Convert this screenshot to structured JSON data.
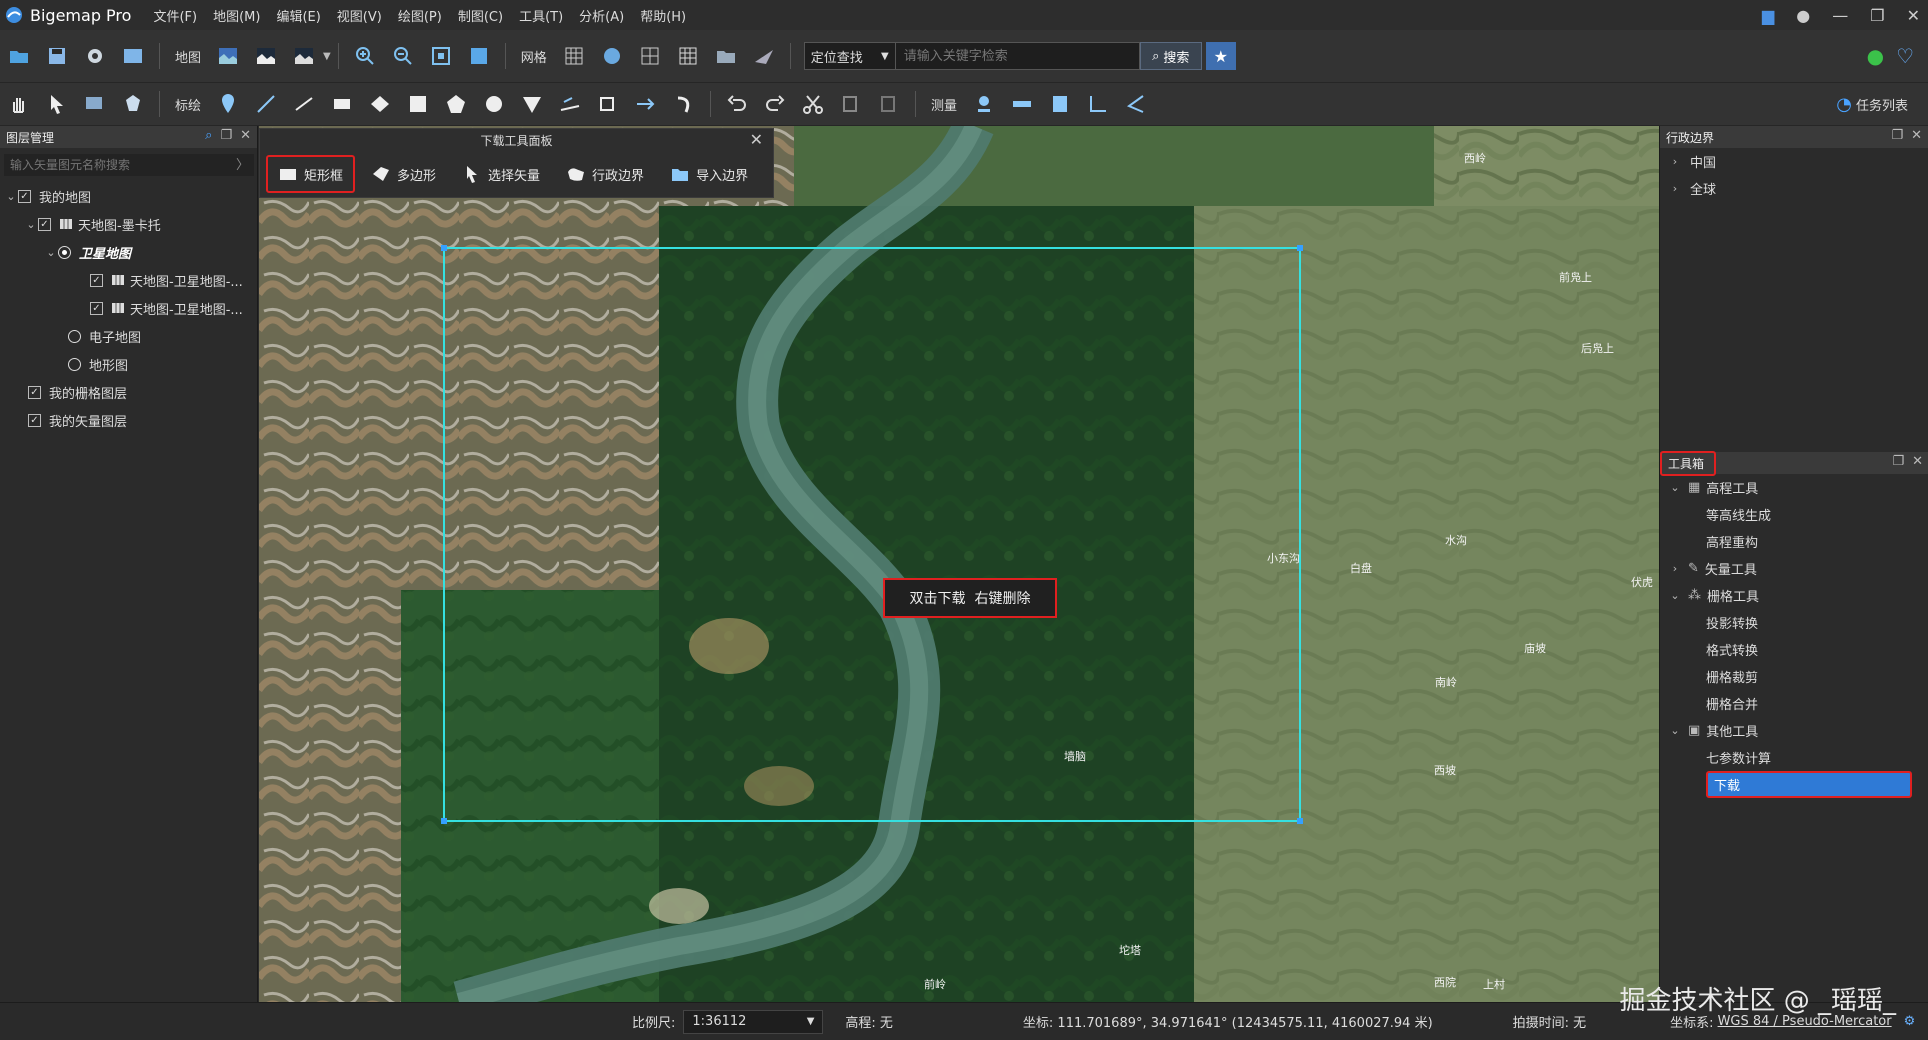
{
  "app": {
    "title": "Bigemap Pro"
  },
  "menu": [
    "文件(F)",
    "地图(M)",
    "编辑(E)",
    "视图(V)",
    "绘图(P)",
    "制图(C)",
    "工具(T)",
    "分析(A)",
    "帮助(H)"
  ],
  "toolbar1": {
    "map_label": "地图",
    "grid_label": "网格",
    "locate_label": "定位查找",
    "search_placeholder": "请输入关键字检索",
    "search_button": "搜索"
  },
  "toolbar2": {
    "annotate_label": "标绘",
    "measure_label": "测量",
    "task_list": "任务列表"
  },
  "layer_panel": {
    "title": "图层管理",
    "search_placeholder": "输入矢量图元名称搜索",
    "items": [
      {
        "label": "我的地图"
      },
      {
        "label": "天地图-墨卡托"
      },
      {
        "label": "卫星地图"
      },
      {
        "label": "天地图-卫星地图-..."
      },
      {
        "label": "天地图-卫星地图-..."
      },
      {
        "label": "电子地图"
      },
      {
        "label": "地形图"
      },
      {
        "label": "我的栅格图层"
      },
      {
        "label": "我的矢量图层"
      }
    ]
  },
  "download_panel": {
    "title": "下载工具面板",
    "tools": [
      "矩形框",
      "多边形",
      "选择矢量",
      "行政边界",
      "导入边界"
    ]
  },
  "map": {
    "hint": "双击下载  右键删除",
    "place_labels": [
      "西岭",
      "前凫上",
      "后凫上",
      "小东沟",
      "白盘",
      "水沟",
      "伏虎",
      "庙坡",
      "南岭",
      "西坡",
      "墙脑",
      "坨塔",
      "西院",
      "上村",
      "前岭"
    ]
  },
  "admin_panel": {
    "title": "行政边界",
    "items": [
      "中国",
      "全球"
    ]
  },
  "toolbox": {
    "title": "工具箱",
    "groups": [
      {
        "label": "高程工具",
        "children": [
          "等高线生成",
          "高程重构"
        ]
      },
      {
        "label": "矢量工具",
        "children": []
      },
      {
        "label": "栅格工具",
        "children": [
          "投影转换",
          "格式转换",
          "栅格裁剪",
          "栅格合并"
        ]
      },
      {
        "label": "其他工具",
        "children": [
          "七参数计算",
          "下载"
        ]
      }
    ]
  },
  "status": {
    "scale_label": "比例尺:",
    "scale_value": "1:36112",
    "elevation": "高程: 无",
    "coords": "坐标: 111.701689°, 34.971641°  (12434575.11, 4160027.94 米)",
    "capture_time": "拍摄时间: 无",
    "crs_label": "坐标系:",
    "crs_value": "WGS 84 / Pseudo-Mercator"
  },
  "watermark": "掘金技术社区 @ _瑶瑶_",
  "colors": {
    "accent": "#2f7ad6",
    "highlight": "#e02020",
    "selection": "#35e0e0"
  }
}
